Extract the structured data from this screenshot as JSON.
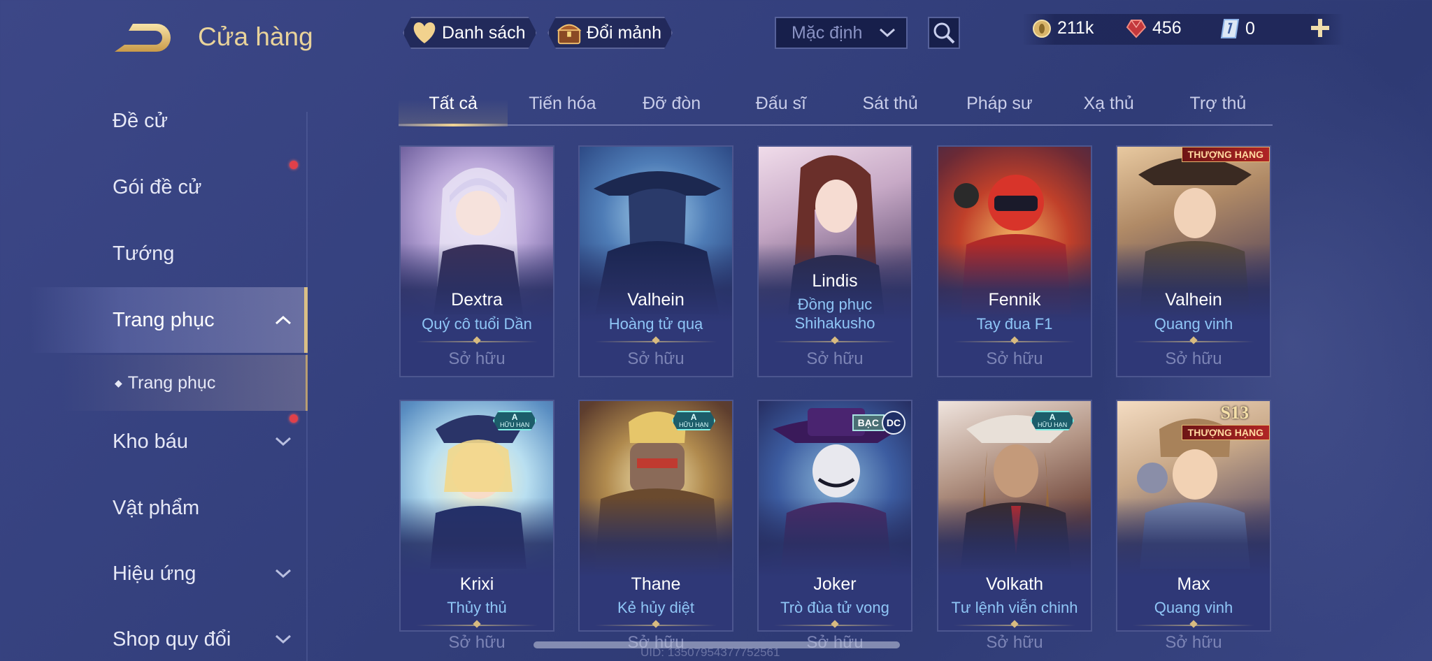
{
  "header": {
    "title": "Cửa hàng",
    "wishlist_label": "Danh sách",
    "exchange_label": "Đổi mảnh",
    "sort": {
      "selected": "Mặc định"
    }
  },
  "currencies": [
    {
      "icon": "gold-coin-icon",
      "value": "211k"
    },
    {
      "icon": "ruby-gem-icon",
      "value": "456"
    },
    {
      "icon": "voucher-icon",
      "value": "0"
    }
  ],
  "sidebar": {
    "items": [
      {
        "label": "Đề cử"
      },
      {
        "label": "Gói đề cử",
        "notification": true
      },
      {
        "label": "Tướng"
      },
      {
        "label": "Trang phục",
        "expanded": true,
        "active": true
      },
      {
        "label": "Trang phục",
        "sub": true
      },
      {
        "label": "Kho báu",
        "notification": true,
        "collapsed": true
      },
      {
        "label": "Vật phẩm"
      },
      {
        "label": "Hiệu ứng",
        "collapsed": true
      },
      {
        "label": "Shop quy đổi",
        "collapsed": true
      }
    ],
    "sub_bullet": "◆"
  },
  "tabs": [
    {
      "label": "Tất cả",
      "active": true
    },
    {
      "label": "Tiến hóa"
    },
    {
      "label": "Đỡ đòn"
    },
    {
      "label": "Đấu sĩ"
    },
    {
      "label": "Sát thủ"
    },
    {
      "label": "Pháp sư"
    },
    {
      "label": "Xạ thủ"
    },
    {
      "label": "Trợ thủ"
    }
  ],
  "cards": [
    {
      "hero": "Dextra",
      "skin": "Quý cô tuổi Dần",
      "status": "Sở hữu"
    },
    {
      "hero": "Valhein",
      "skin": "Hoàng tử quạ",
      "status": "Sở hữu"
    },
    {
      "hero": "Lindis",
      "skin": "Đồng phục Shihakusho",
      "status": "Sở hữu"
    },
    {
      "hero": "Fennik",
      "skin": "Tay đua F1",
      "status": "Sở hữu"
    },
    {
      "hero": "Valhein",
      "skin": "Quang vinh",
      "status": "Sở hữu",
      "rank_badge": "THƯỢNG HẠNG"
    },
    {
      "hero": "Krixi",
      "skin": "Thủy thủ",
      "status": "Sở hữu",
      "badge": {
        "top": "A",
        "bottom": "HỮU HẠN"
      }
    },
    {
      "hero": "Thane",
      "skin": "Kẻ hủy diệt",
      "status": "Sở hữu",
      "badge": {
        "top": "A",
        "bottom": "HỮU HẠN"
      }
    },
    {
      "hero": "Joker",
      "skin": "Trò đùa tử vong",
      "status": "Sở hữu",
      "dc_badge": {
        "tier": "BẠC",
        "brand": "DC"
      }
    },
    {
      "hero": "Volkath",
      "skin": "Tư lệnh viễn chinh",
      "status": "Sở hữu",
      "badge": {
        "top": "A",
        "bottom": "HỮU HẠN"
      }
    },
    {
      "hero": "Max",
      "skin": "Quang vinh",
      "status": "Sở hữu",
      "rank_badge": "THƯỢNG HẠNG",
      "season": "S13"
    }
  ],
  "footer": {
    "uid": "UID: 13507954377752561"
  },
  "colors": {
    "accent_gold": "#e9d39a",
    "skin_name_blue": "#8fc6f6",
    "notification_red": "#e0404a"
  }
}
